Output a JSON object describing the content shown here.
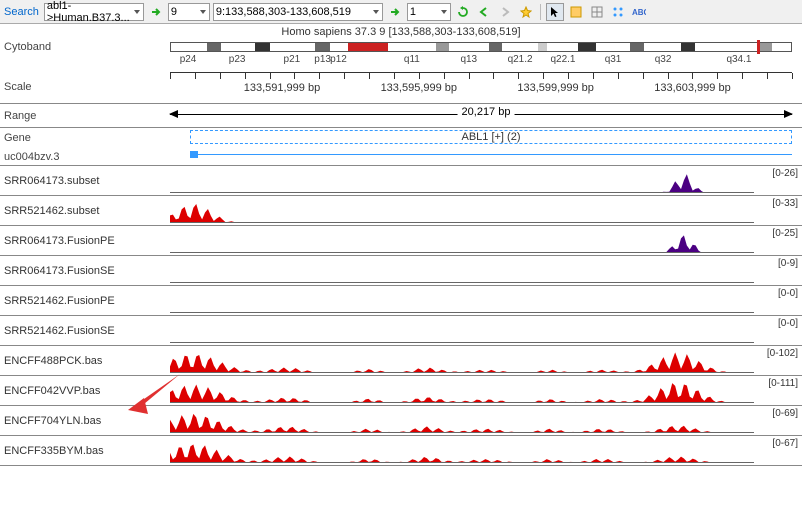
{
  "toolbar": {
    "search_label": "Search",
    "search_value": "abl1->Human.B37.3...",
    "chrom": "9",
    "location": "9:133,588,303-133,608,519",
    "go": "1"
  },
  "cytoband": {
    "label": "Cytoband",
    "title": "Homo sapiens 37.3 9 [133,588,303-133,608,519]",
    "bands": [
      {
        "n": "p24",
        "w": 5.8,
        "c": "gneg"
      },
      {
        "n": "",
        "w": 2.3,
        "c": "g75"
      },
      {
        "n": "p23",
        "w": 5.4,
        "c": "gneg"
      },
      {
        "n": "",
        "w": 2.5,
        "c": "g100"
      },
      {
        "n": "p21",
        "w": 7.2,
        "c": "gneg"
      },
      {
        "n": "p13",
        "w": 2.4,
        "c": "g75"
      },
      {
        "n": "p12",
        "w": 3.0,
        "c": "gneg"
      },
      {
        "n": "",
        "w": 3.2,
        "c": "acen"
      },
      {
        "n": "",
        "w": 3.2,
        "c": "acen"
      },
      {
        "n": "q11",
        "w": 7.8,
        "c": "gneg"
      },
      {
        "n": "",
        "w": 2.0,
        "c": "g50"
      },
      {
        "n": "q13",
        "w": 6.5,
        "c": "gneg"
      },
      {
        "n": "",
        "w": 2.1,
        "c": "g75"
      },
      {
        "n": "q21.2",
        "w": 5.8,
        "c": "gneg"
      },
      {
        "n": "",
        "w": 1.5,
        "c": "g25"
      },
      {
        "n": "q22.1",
        "w": 5.0,
        "c": "gneg"
      },
      {
        "n": "",
        "w": 2.8,
        "c": "g100"
      },
      {
        "n": "q31",
        "w": 5.5,
        "c": "gneg"
      },
      {
        "n": "",
        "w": 2.3,
        "c": "g75"
      },
      {
        "n": "q32",
        "w": 6.0,
        "c": "gneg"
      },
      {
        "n": "",
        "w": 2.2,
        "c": "g100"
      },
      {
        "n": "",
        "w": 3.5,
        "c": "gneg"
      },
      {
        "n": "q34.1",
        "w": 7.0,
        "c": "gneg"
      },
      {
        "n": "",
        "w": 2.0,
        "c": "g50"
      },
      {
        "n": "",
        "w": 3.0,
        "c": "gneg"
      }
    ]
  },
  "scale": {
    "label": "Scale",
    "ticks": [
      "133,591,999 bp",
      "133,595,999 bp",
      "133,599,999 bp",
      "133,603,999 bp"
    ],
    "positions": [
      18,
      40,
      62,
      84
    ]
  },
  "range": {
    "label": "Range",
    "span": "20,217 bp"
  },
  "gene": {
    "label": "Gene",
    "name": "ABL1 [+] (2)"
  },
  "transcript": {
    "label": "uc004bzv.3"
  },
  "tracks": [
    {
      "name": "SRR064173.subset",
      "range": "[0-26]",
      "color": "#4b0082",
      "peaks": [
        [
          88,
          0.9,
          3
        ]
      ]
    },
    {
      "name": "SRR521462.subset",
      "range": "[0-33]",
      "color": "#d00",
      "peaks": [
        [
          4,
          0.9,
          6
        ]
      ]
    },
    {
      "name": "SRR064173.FusionPE",
      "range": "[0-25]",
      "color": "#4b0082",
      "peaks": [
        [
          88,
          0.85,
          3
        ]
      ]
    },
    {
      "name": "SRR064173.FusionSE",
      "range": "[0-9]",
      "color": "#4b0082",
      "peaks": []
    },
    {
      "name": "SRR521462.FusionPE",
      "range": "[0-0]",
      "color": "#d00",
      "peaks": []
    },
    {
      "name": "SRR521462.FusionSE",
      "range": "[0-0]",
      "color": "#d00",
      "peaks": []
    },
    {
      "name": "ENCFF488PCK.bas",
      "range": "[0-102]",
      "color": "#d00",
      "peaks": [
        [
          4,
          0.9,
          9
        ],
        [
          20,
          0.25,
          6
        ],
        [
          34,
          0.18,
          4
        ],
        [
          44,
          0.25,
          5
        ],
        [
          54,
          0.15,
          6
        ],
        [
          65,
          0.15,
          4
        ],
        [
          74,
          0.15,
          5
        ],
        [
          87,
          0.95,
          7
        ]
      ]
    },
    {
      "name": "ENCFF042VVP.bas",
      "range": "[0-111]",
      "color": "#d00",
      "peaks": [
        [
          4,
          0.85,
          9
        ],
        [
          20,
          0.25,
          6
        ],
        [
          34,
          0.2,
          4
        ],
        [
          44,
          0.28,
          5
        ],
        [
          54,
          0.18,
          6
        ],
        [
          65,
          0.18,
          4
        ],
        [
          74,
          0.18,
          5
        ],
        [
          87,
          0.98,
          7
        ]
      ]
    },
    {
      "name": "ENCFF704YLN.bas",
      "range": "[0-69]",
      "color": "#d00",
      "peaks": [
        [
          4,
          0.9,
          9
        ],
        [
          20,
          0.3,
          6
        ],
        [
          34,
          0.2,
          4
        ],
        [
          44,
          0.3,
          5
        ],
        [
          54,
          0.2,
          6
        ],
        [
          65,
          0.2,
          4
        ],
        [
          74,
          0.2,
          5
        ],
        [
          87,
          0.35,
          6
        ]
      ]
    },
    {
      "name": "ENCFF335BYM.bas",
      "range": "[0-67]",
      "color": "#d00",
      "peaks": [
        [
          4,
          0.9,
          9
        ],
        [
          20,
          0.3,
          6
        ],
        [
          34,
          0.2,
          4
        ],
        [
          44,
          0.28,
          5
        ],
        [
          54,
          0.18,
          6
        ],
        [
          65,
          0.18,
          4
        ],
        [
          74,
          0.2,
          5
        ],
        [
          87,
          0.3,
          6
        ]
      ]
    }
  ]
}
